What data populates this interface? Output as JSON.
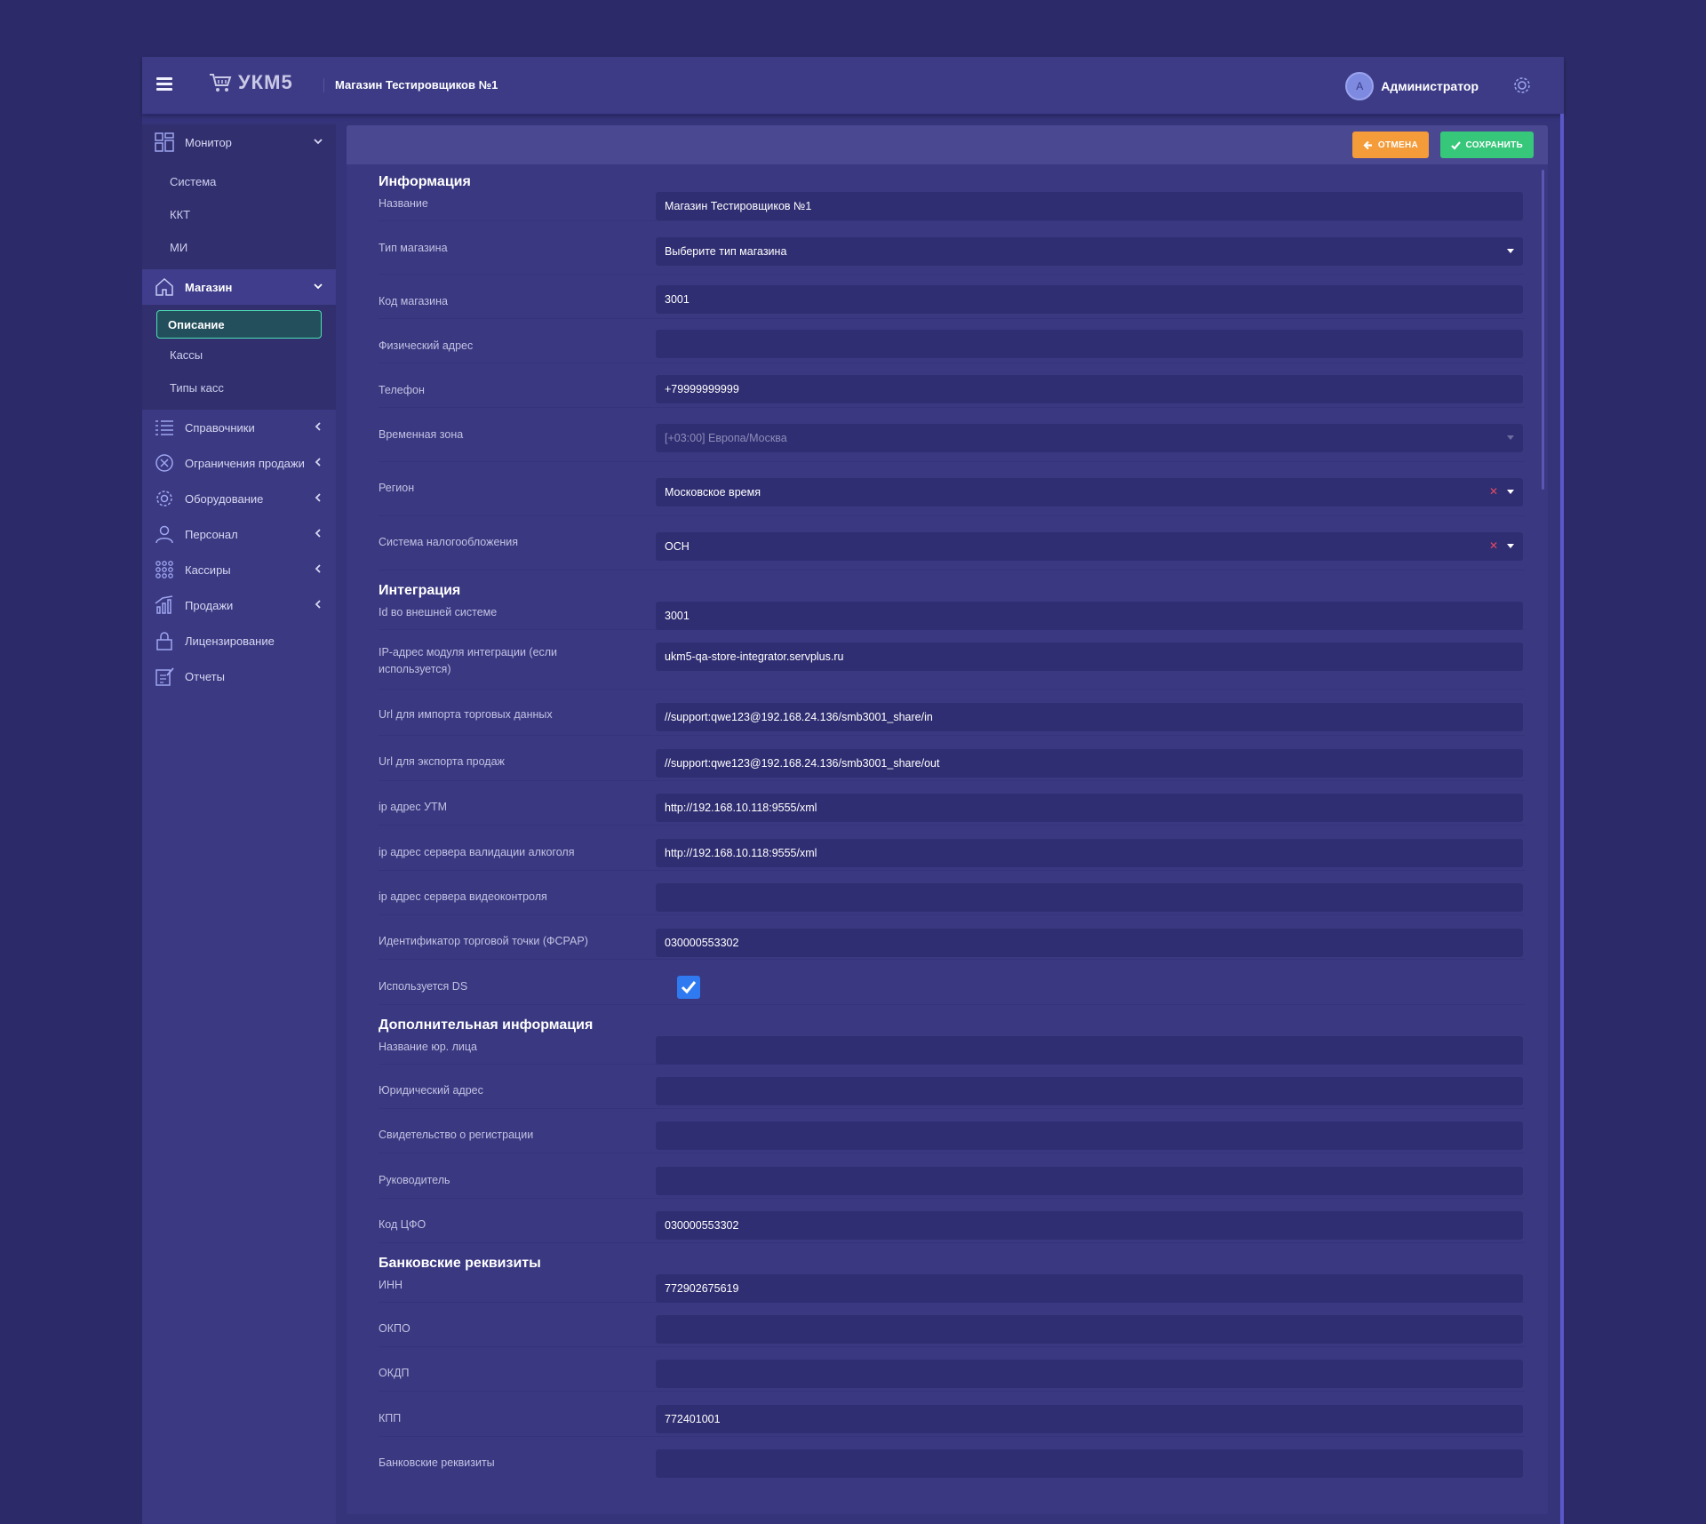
{
  "header": {
    "logo_text": "УКМ5",
    "store_title": "Магазин Тестировщиков №1",
    "user_initial": "А",
    "user_name": "Администратор"
  },
  "sidebar": {
    "items": [
      {
        "label": "Монитор",
        "icon": "grid-icon",
        "state": "expanded",
        "sub": [
          "Система",
          "ККТ",
          "МИ"
        ]
      },
      {
        "label": "Магазин",
        "icon": "home-icon",
        "state": "expanded",
        "sub": [
          "Описание",
          "Кассы",
          "Типы касс"
        ],
        "active_sub": "Описание"
      },
      {
        "label": "Справочники",
        "icon": "list-icon",
        "state": "collapsed"
      },
      {
        "label": "Ограничения продажи",
        "icon": "cancel-circle-icon",
        "state": "collapsed"
      },
      {
        "label": "Оборудование",
        "icon": "gear-icon",
        "state": "collapsed"
      },
      {
        "label": "Персонал",
        "icon": "person-icon",
        "state": "collapsed"
      },
      {
        "label": "Кассиры",
        "icon": "dots-grid-icon",
        "state": "collapsed"
      },
      {
        "label": "Продажи",
        "icon": "chart-icon",
        "state": "collapsed"
      },
      {
        "label": "Лицензирование",
        "icon": "lock-icon"
      },
      {
        "label": "Отчеты",
        "icon": "report-icon"
      }
    ]
  },
  "toolbar": {
    "cancel_label": "ОТМЕНА",
    "save_label": "СОХРАНИТЬ"
  },
  "sections": {
    "info": {
      "title": "Информация",
      "name": {
        "label": "Название",
        "value": "Магазин Тестировщиков №1"
      },
      "store_type": {
        "label": "Тип магазина",
        "value": "Выберите тип магазина"
      },
      "store_code": {
        "label": "Код магазина",
        "value": "3001"
      },
      "address": {
        "label": "Физический адрес",
        "value": ""
      },
      "phone": {
        "label": "Телефон",
        "value": "+79999999999"
      },
      "timezone": {
        "label": "Временная зона",
        "value": "[+03:00] Европа/Москва"
      },
      "region": {
        "label": "Регион",
        "value": "Московское время"
      },
      "tax": {
        "label": "Система налогообложения",
        "value": "ОСН"
      }
    },
    "integration": {
      "title": "Интеграция",
      "ext_id": {
        "label": "Id во внешней системе",
        "value": "3001"
      },
      "ip_module": {
        "label": "IP-адрес модуля интеграции (если используется)",
        "value": "ukm5-qa-store-integrator.servplus.ru"
      },
      "url_import": {
        "label": "Url для импорта торговых данных",
        "value": "//support:qwe123@192.168.24.136/smb3001_share/in"
      },
      "url_export": {
        "label": "Url для экспорта продаж",
        "value": "//support:qwe123@192.168.24.136/smb3001_share/out"
      },
      "utm": {
        "label": "ip адрес УТМ",
        "value": "http://192.168.10.118:9555/xml"
      },
      "alco": {
        "label": "ip адрес сервера валидации алкоголя",
        "value": "http://192.168.10.118:9555/xml"
      },
      "video": {
        "label": "ip адрес сервера видеоконтроля",
        "value": ""
      },
      "fsrar": {
        "label": "Идентификатор торговой точки (ФСРАР)",
        "value": "030000553302"
      },
      "ds": {
        "label": "Используется DS",
        "checked": true
      }
    },
    "additional": {
      "title": "Дополнительная информация",
      "legal_name": {
        "label": "Название юр. лица",
        "value": ""
      },
      "legal_address": {
        "label": "Юридический адрес",
        "value": ""
      },
      "reg_cert": {
        "label": "Свидетельство о регистрации",
        "value": ""
      },
      "director": {
        "label": "Руководитель",
        "value": ""
      },
      "cfo_code": {
        "label": "Код ЦФО",
        "value": "030000553302"
      }
    },
    "bank": {
      "title": "Банковские реквизиты",
      "inn": {
        "label": "ИНН",
        "value": "772902675619"
      },
      "okpo": {
        "label": "ОКПО",
        "value": ""
      },
      "okdp": {
        "label": "ОКДП",
        "value": ""
      },
      "kpp": {
        "label": "КПП",
        "value": "772401001"
      },
      "bank_details": {
        "label": "Банковские реквизиты",
        "value": ""
      }
    }
  },
  "colors": {
    "background": "#2c2a68",
    "cancel": "#f49b3a",
    "save": "#37c77a",
    "active_border": "#4de0b4",
    "checkbox": "#2f7af0",
    "clear": "#e04a63"
  }
}
